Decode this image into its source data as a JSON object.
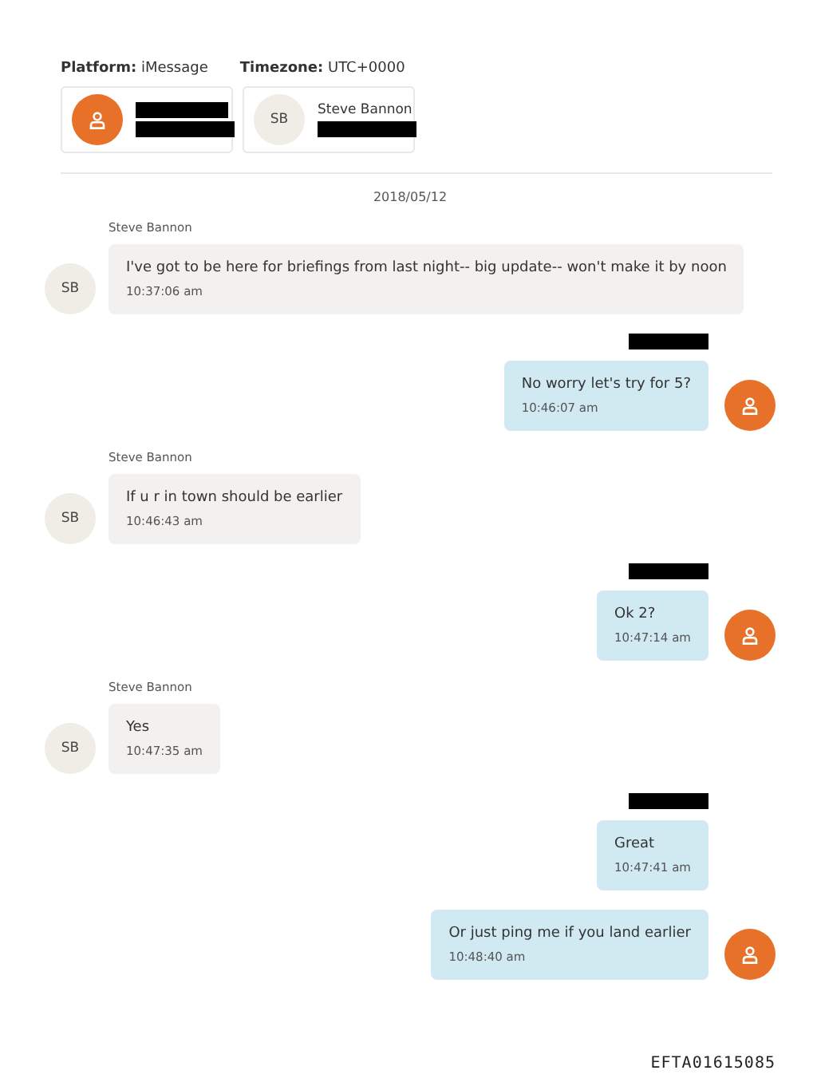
{
  "header": {
    "platform_label": "Platform:",
    "platform": "iMessage",
    "timezone_label": "Timezone:",
    "timezone": "UTC+0000"
  },
  "participants": [
    {
      "kind": "self",
      "redacted": true
    },
    {
      "kind": "contact",
      "initials": "SB",
      "name": "Steve Bannon",
      "redacted": true
    }
  ],
  "date": "2018/05/12",
  "messages": [
    {
      "kind": "received",
      "sender": "Steve Bannon",
      "initials": "SB",
      "text": "I've got to be here for briefings from last night-- big update-- won't make it by noon",
      "time": "10:37:06 am"
    },
    {
      "kind": "sent",
      "sender_redacted": true,
      "avatar": true,
      "text": "No worry  let's try for 5?",
      "time": "10:46:07 am"
    },
    {
      "kind": "received",
      "sender": "Steve Bannon",
      "initials": "SB",
      "text": "If u r in town should be earlier",
      "time": "10:46:43 am"
    },
    {
      "kind": "sent",
      "sender_redacted": true,
      "avatar": true,
      "text": "Ok  2?",
      "time": "10:47:14 am"
    },
    {
      "kind": "received",
      "sender": "Steve Bannon",
      "initials": "SB",
      "text": "Yes",
      "time": "10:47:35 am"
    },
    {
      "kind": "sent",
      "sender_redacted": true,
      "avatar": false,
      "text": "Great",
      "time": "10:47:41 am"
    },
    {
      "kind": "sent",
      "avatar": true,
      "text": "Or just ping me if you land earlier",
      "time": "10:48:40 am"
    }
  ],
  "footer": "EFTA01615085"
}
